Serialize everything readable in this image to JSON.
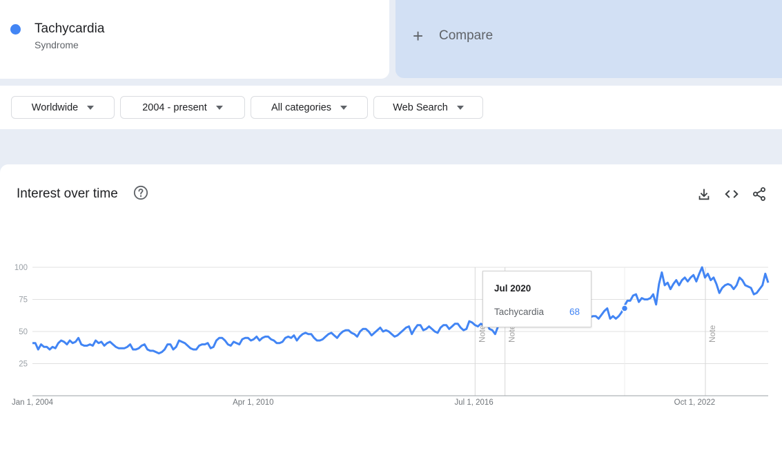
{
  "term": {
    "name": "Tachycardia",
    "type": "Syndrome",
    "color": "#4285f4"
  },
  "compare": {
    "label": "Compare"
  },
  "filters": [
    {
      "label": "Worldwide"
    },
    {
      "label": "2004 - present"
    },
    {
      "label": "All categories"
    },
    {
      "label": "Web Search"
    }
  ],
  "chart_card": {
    "title": "Interest over time",
    "help_icon": "help-circle-icon",
    "actions": [
      "download-icon",
      "embed-code-icon",
      "share-icon"
    ]
  },
  "annotations": {
    "note_label": "Note"
  },
  "tooltip": {
    "date": "Jul 2020",
    "term": "Tachycardia",
    "value": "68"
  },
  "chart_data": {
    "type": "line",
    "title": "",
    "xlabel": "",
    "ylabel": "",
    "x_start": "2004-01",
    "x_end": "2024-07",
    "x_ticks": [
      "Jan 1, 2004",
      "Apr 1, 2010",
      "Jul 1, 2016",
      "Oct 1, 2022"
    ],
    "ylim": [
      0,
      100
    ],
    "y_ticks": [
      25,
      50,
      75,
      100
    ],
    "grid": true,
    "note_markers": [
      "2016-05",
      "2017-03",
      "2022-10"
    ],
    "highlight": {
      "date": "2020-07",
      "value": 68
    },
    "series": [
      {
        "name": "Tachycardia",
        "color": "#4285f4",
        "values": [
          41,
          41,
          36,
          40,
          38,
          38,
          36,
          38,
          37,
          41,
          43,
          42,
          40,
          43,
          41,
          42,
          45,
          40,
          39,
          39,
          40,
          39,
          43,
          41,
          42,
          39,
          41,
          42,
          40,
          38,
          37,
          37,
          37,
          38,
          40,
          36,
          36,
          37,
          39,
          40,
          36,
          35,
          35,
          34,
          33,
          34,
          36,
          40,
          40,
          36,
          38,
          43,
          42,
          41,
          39,
          37,
          36,
          36,
          39,
          40,
          40,
          41,
          37,
          38,
          43,
          45,
          45,
          43,
          40,
          39,
          42,
          41,
          40,
          44,
          45,
          45,
          43,
          44,
          46,
          43,
          45,
          46,
          46,
          44,
          43,
          41,
          41,
          42,
          45,
          46,
          45,
          47,
          43,
          46,
          48,
          49,
          48,
          48,
          45,
          43,
          43,
          44,
          46,
          48,
          49,
          47,
          45,
          48,
          50,
          51,
          51,
          49,
          48,
          46,
          50,
          52,
          52,
          50,
          47,
          49,
          51,
          53,
          50,
          51,
          50,
          48,
          46,
          47,
          49,
          51,
          53,
          54,
          48,
          52,
          55,
          55,
          51,
          52,
          54,
          52,
          50,
          49,
          53,
          55,
          55,
          52,
          54,
          56,
          56,
          53,
          51,
          52,
          58,
          57,
          55,
          54,
          56,
          55,
          57,
          52,
          51,
          48,
          54,
          56,
          58,
          62,
          57,
          59,
          62,
          60,
          60,
          58,
          63,
          65,
          64,
          62,
          61,
          60,
          64,
          62,
          56,
          58,
          60,
          58,
          62,
          60,
          58,
          60,
          56,
          58,
          61,
          63,
          58,
          60,
          61,
          62,
          62,
          60,
          63,
          66,
          68,
          60,
          62,
          60,
          62,
          65,
          70,
          74,
          74,
          78,
          79,
          73,
          76,
          75,
          75,
          76,
          79,
          71,
          87,
          96,
          86,
          88,
          83,
          87,
          90,
          86,
          90,
          92,
          89,
          92,
          94,
          89,
          95,
          100,
          92,
          95,
          90,
          92,
          87,
          80,
          84,
          86,
          87,
          86,
          83,
          86,
          92,
          90,
          86,
          85,
          84,
          79,
          80,
          83,
          86,
          95,
          88
        ]
      }
    ]
  }
}
